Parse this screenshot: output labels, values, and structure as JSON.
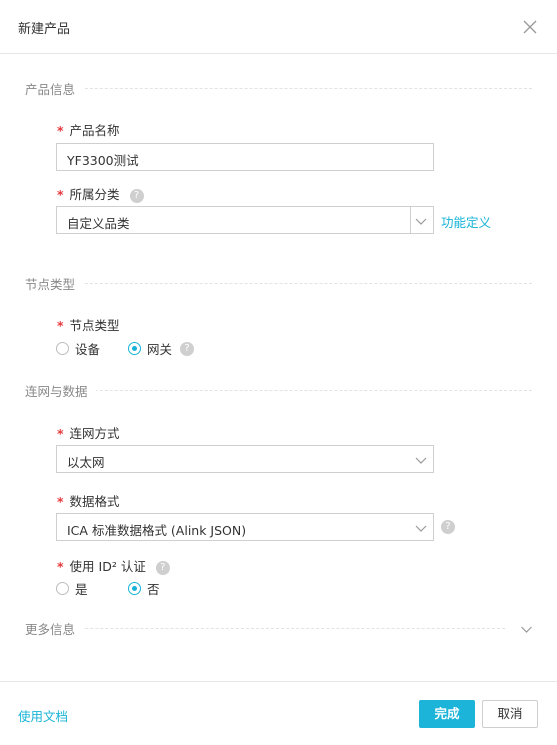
{
  "dialog": {
    "title": "新建产品"
  },
  "sections": {
    "product_info": "产品信息",
    "node_type": "节点类型",
    "network": "连网与数据",
    "more": "更多信息"
  },
  "form": {
    "required_mark": "*",
    "product_name": {
      "label": "产品名称",
      "value": "YF3300测试"
    },
    "category": {
      "label": "所属分类",
      "value": "自定义品类",
      "link": "功能定义"
    },
    "node_type": {
      "label": "节点类型",
      "options": [
        {
          "label": "设备",
          "selected": false
        },
        {
          "label": "网关",
          "selected": true
        }
      ]
    },
    "connection": {
      "label": "连网方式",
      "value": "以太网"
    },
    "data_format": {
      "label": "数据格式",
      "value": "ICA 标准数据格式 (Alink JSON)"
    },
    "id2_auth": {
      "label": "使用 ID² 认证",
      "options": [
        {
          "label": "是",
          "selected": false
        },
        {
          "label": "否",
          "selected": true
        }
      ]
    }
  },
  "footer": {
    "docs_link": "使用文档",
    "confirm_label": "完成",
    "cancel_label": "取消"
  },
  "colors": {
    "accent": "#1cb4d8",
    "required": "#e4393c"
  },
  "icons": [
    "close-icon",
    "help-icon",
    "chevron-down-icon"
  ]
}
